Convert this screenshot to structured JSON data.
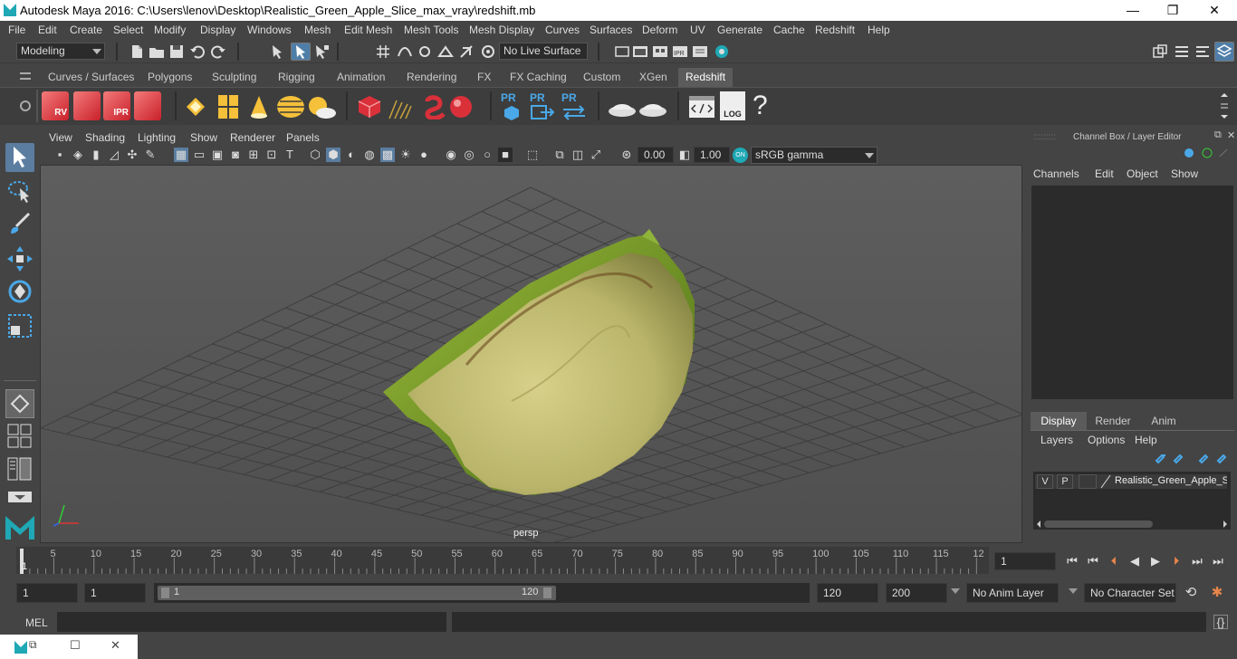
{
  "window": {
    "title": "Autodesk Maya 2016: C:\\Users\\lenov\\Desktop\\Realistic_Green_Apple_Slice_max_vray\\redshift.mb",
    "minimize": "—",
    "maximize": "❐",
    "close": "✕"
  },
  "menubar": [
    "File",
    "Edit",
    "Create",
    "Select",
    "Modify",
    "Display",
    "Windows",
    "Mesh",
    "Edit Mesh",
    "Mesh Tools",
    "Mesh Display",
    "Curves",
    "Surfaces",
    "Deform",
    "UV",
    "Generate",
    "Cache",
    "Redshift",
    "Help"
  ],
  "statusline": {
    "mode": "Modeling",
    "live_surface": "No Live Surface"
  },
  "shelf_tabs": [
    "Curves / Surfaces",
    "Polygons",
    "Sculpting",
    "Rigging",
    "Animation",
    "Rendering",
    "FX",
    "FX Caching",
    "Custom",
    "XGen",
    "Redshift"
  ],
  "shelf_active": "Redshift",
  "shelf_icons": {
    "rv": "RV",
    "ipr": "IPR",
    "pr1": "PR",
    "pr2": "PR",
    "pr3": "PR",
    "log": "LOG",
    "help": "?"
  },
  "viewport": {
    "menu": [
      "View",
      "Shading",
      "Lighting",
      "Show",
      "Renderer",
      "Panels"
    ],
    "exposure": "0.00",
    "gamma": "1.00",
    "color_space": "sRGB gamma",
    "camera": "persp"
  },
  "channelbox": {
    "title": "Channel Box / Layer Editor",
    "menu": [
      "Channels",
      "Edit",
      "Object",
      "Show"
    ]
  },
  "layereditor": {
    "tabs": [
      "Display",
      "Render",
      "Anim"
    ],
    "active_tab": "Display",
    "menu": [
      "Layers",
      "Options",
      "Help"
    ],
    "layer": {
      "v": "V",
      "p": "P",
      "name": "Realistic_Green_Apple_S"
    }
  },
  "timeslider": {
    "ticks": [
      "5",
      "10",
      "15",
      "20",
      "25",
      "30",
      "35",
      "40",
      "45",
      "50",
      "55",
      "60",
      "65",
      "70",
      "75",
      "80",
      "85",
      "90",
      "95",
      "100",
      "105",
      "110",
      "115",
      "12"
    ],
    "start_marker": "1",
    "current_frame": "1"
  },
  "rangeslider": {
    "start": "1",
    "playback_start": "1",
    "range_start_label": "1",
    "range_end_label": "120",
    "playback_end": "120",
    "end": "200",
    "anim_layer": "No Anim Layer",
    "character_set": "No Character Set"
  },
  "cmdline": {
    "label": "MEL"
  },
  "colors": {
    "accent": "#1fa8b5",
    "redshift_red": "#d9303a",
    "apple_flesh": "#c8c57a",
    "apple_skin": "#7a9a25"
  }
}
